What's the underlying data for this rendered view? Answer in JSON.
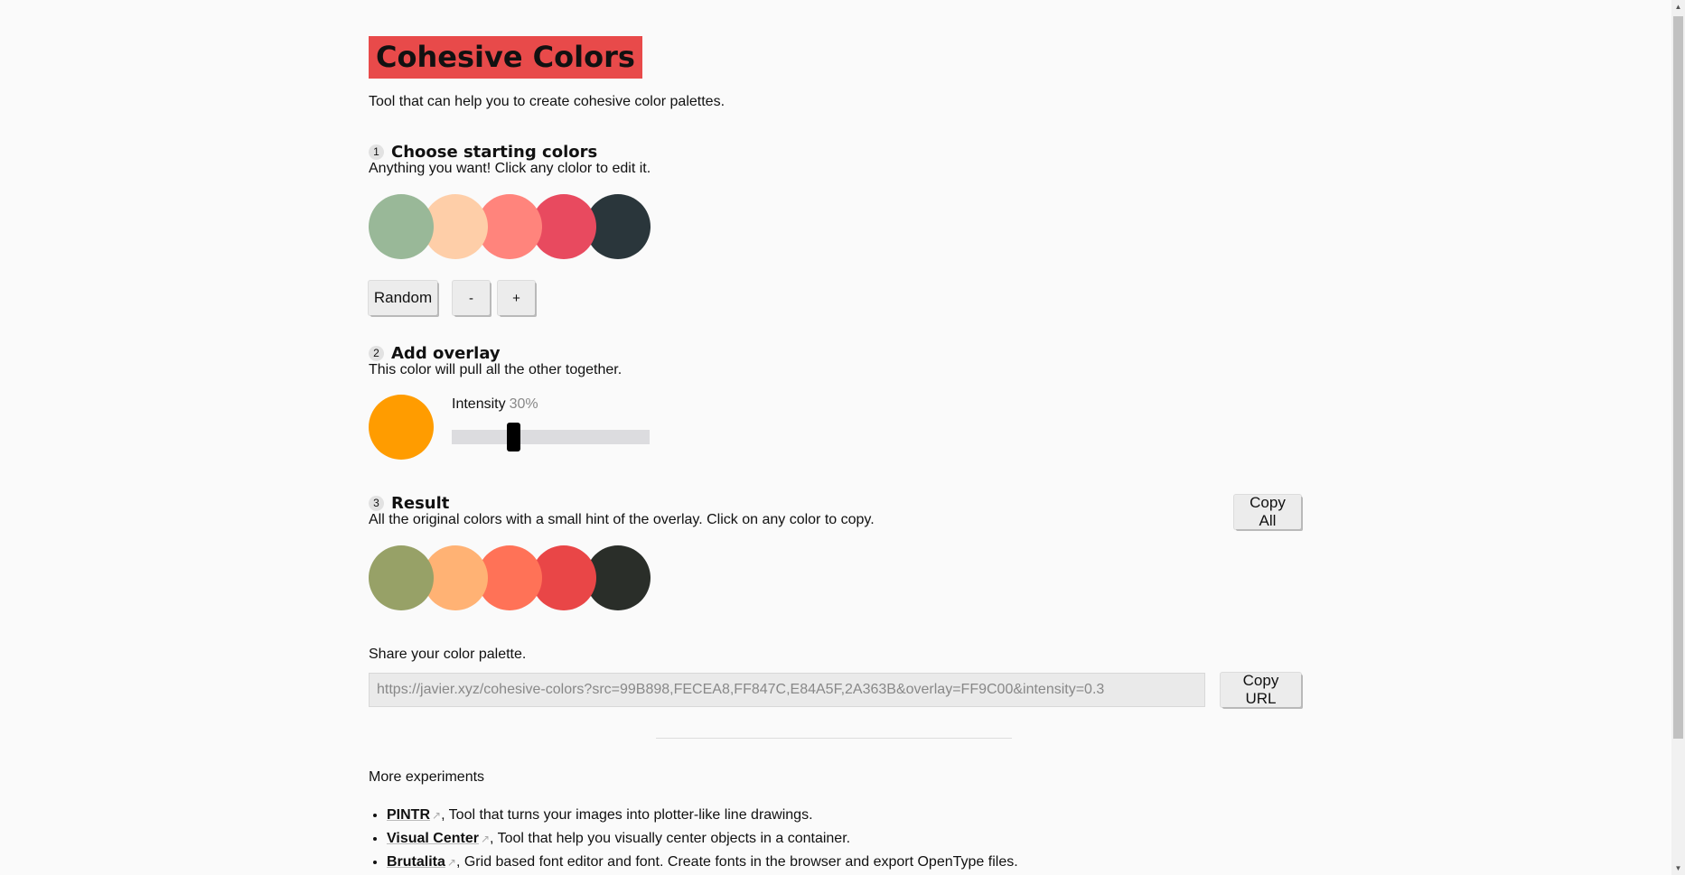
{
  "header": {
    "title": "Cohesive Colors",
    "intro": "Tool that can help you to create cohesive color palettes."
  },
  "step1": {
    "num": "1",
    "title": "Choose starting colors",
    "desc": "Anything you want! Click any clolor to edit it.",
    "colors": [
      "#99B898",
      "#FECEA8",
      "#FF847C",
      "#E84A5F",
      "#2A363B"
    ],
    "random_label": "Random",
    "minus_label": "-",
    "plus_label": "+"
  },
  "step2": {
    "num": "2",
    "title": "Add overlay",
    "desc": "This color will pull all the other together.",
    "overlay_color": "#FF9C00",
    "intensity_label": "Intensity",
    "intensity_value": "30%",
    "intensity": 0.3
  },
  "step3": {
    "num": "3",
    "title": "Result",
    "desc": "All the original colors with a small hint of the overlay. Click on any color to copy.",
    "copy_all_label": "Copy All",
    "colors": [
      "#97A167",
      "#FFB274",
      "#FF7257",
      "#E94647",
      "#2A2E29"
    ]
  },
  "share": {
    "label": "Share your color palette.",
    "url": "https://javier.xyz/cohesive-colors?src=99B898,FECEA8,FF847C,E84A5F,2A363B&overlay=FF9C00&intensity=0.3",
    "copy_url_label": "Copy URL"
  },
  "more": {
    "heading": "More experiments",
    "items": [
      {
        "name": "PINTR",
        "desc": ", Tool that turns your images into plotter-like line drawings."
      },
      {
        "name": "Visual Center",
        "desc": ", Tool that help you visually center objects in a container."
      },
      {
        "name": "Brutalita",
        "desc": ", Grid based font editor and font. Create fonts in the browser and export OpenType files."
      }
    ]
  }
}
